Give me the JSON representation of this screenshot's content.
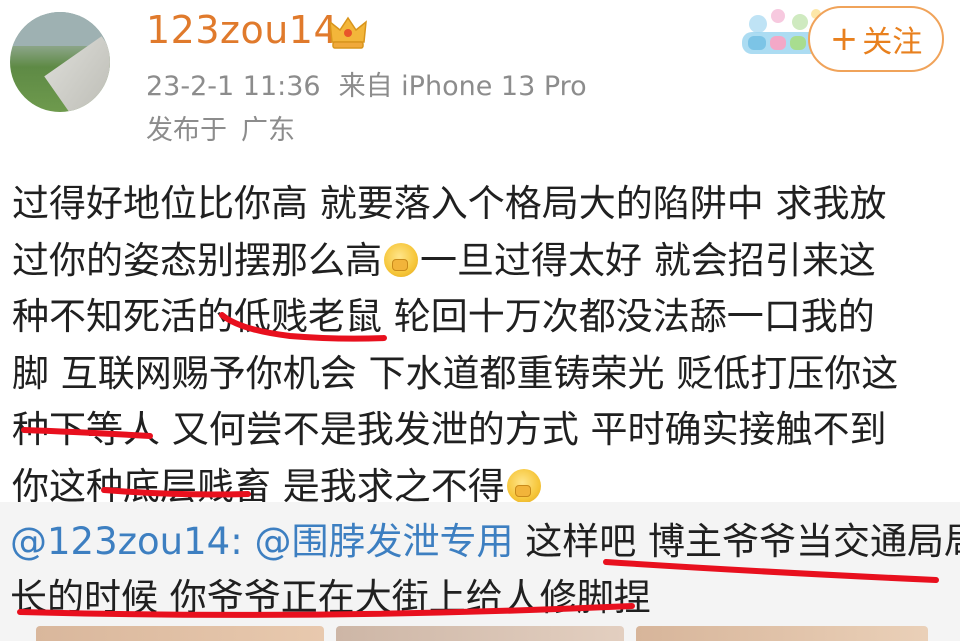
{
  "header": {
    "username": "123zou14",
    "timestamp": "23-2-1 11:36",
    "source": "来自 iPhone 13 Pro",
    "location_prefix": "发布于",
    "location": "广东",
    "follow_label": "关注",
    "follow_plus": "+"
  },
  "post": {
    "lines": [
      "过得好地位比你高 就要落入个格局大的陷阱中 求我放",
      "过你的姿态别摆那么高",
      "一旦过得太好 就会招引来这",
      "种不知死活的低贱老鼠 轮回十万次都没法舔一口我的",
      "脚 互联网赐予你机会 下水道都重铸荣光 贬低打压你这",
      "种下等人 又何尝不是我发泄的方式 平时确实接触不到",
      "你这种底层贱畜 是我求之不得"
    ]
  },
  "repost": {
    "mention_user": "@123zou14:",
    "mention_target": "@围脖发泄专用",
    "text_1": "这样吧 博主爷爷当交通局局",
    "text_2": "长的时候 你爷爷正在大街上给人修脚捏"
  },
  "icons": {
    "crown": "crown-icon",
    "emoji": "clapping-hands-emoji",
    "badge": "colorful-decoration-badge"
  },
  "colors": {
    "username": "#e07a2c",
    "mention": "#3d7fc1",
    "underline": "#e8101e",
    "follow": "#e8801e"
  }
}
